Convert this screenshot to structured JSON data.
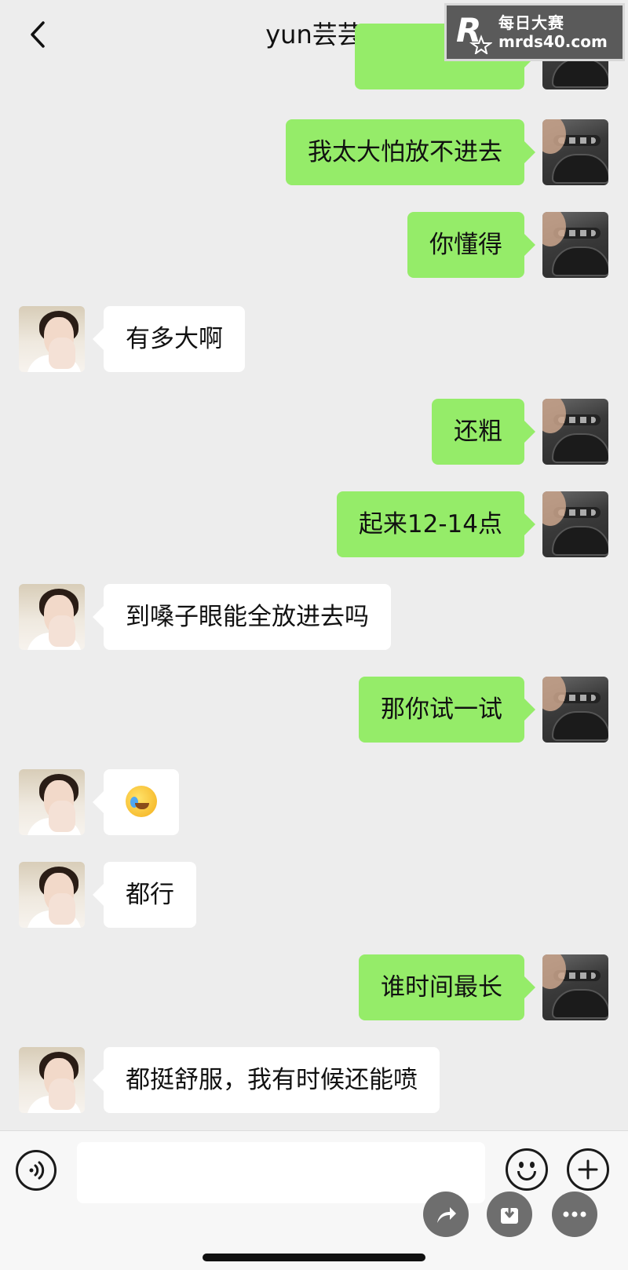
{
  "header": {
    "title": "yun芸芸"
  },
  "watermark": {
    "line1": "每日大赛",
    "line2": "mrds40.com"
  },
  "messages": [
    {
      "side": "me",
      "text": "我太大怕放不进去"
    },
    {
      "side": "me",
      "text": "你懂得"
    },
    {
      "side": "her",
      "text": "有多大啊"
    },
    {
      "side": "me",
      "text": "还粗"
    },
    {
      "side": "me",
      "text": "起来12-14点"
    },
    {
      "side": "her",
      "text": "到嗓子眼能全放进去吗"
    },
    {
      "side": "me",
      "text": "那你试一试"
    },
    {
      "side": "her",
      "emoji": "crying-laughing-emoji"
    },
    {
      "side": "her",
      "text": "都行"
    },
    {
      "side": "me",
      "text": "谁时间最长"
    },
    {
      "side": "her",
      "text": "都挺舒服，我有时候还能喷"
    }
  ],
  "input": {
    "value": "",
    "placeholder": ""
  },
  "icons": {
    "back": "chevron-left-icon",
    "more": "more-dots-icon",
    "voice": "voice-icon",
    "emoji": "emoji-icon",
    "plus": "plus-icon",
    "share": "share-icon",
    "save": "download-icon",
    "fab_more": "more-dots-icon"
  },
  "colors": {
    "my_bubble": "#95ec69",
    "her_bubble": "#ffffff",
    "background": "#ededed"
  }
}
